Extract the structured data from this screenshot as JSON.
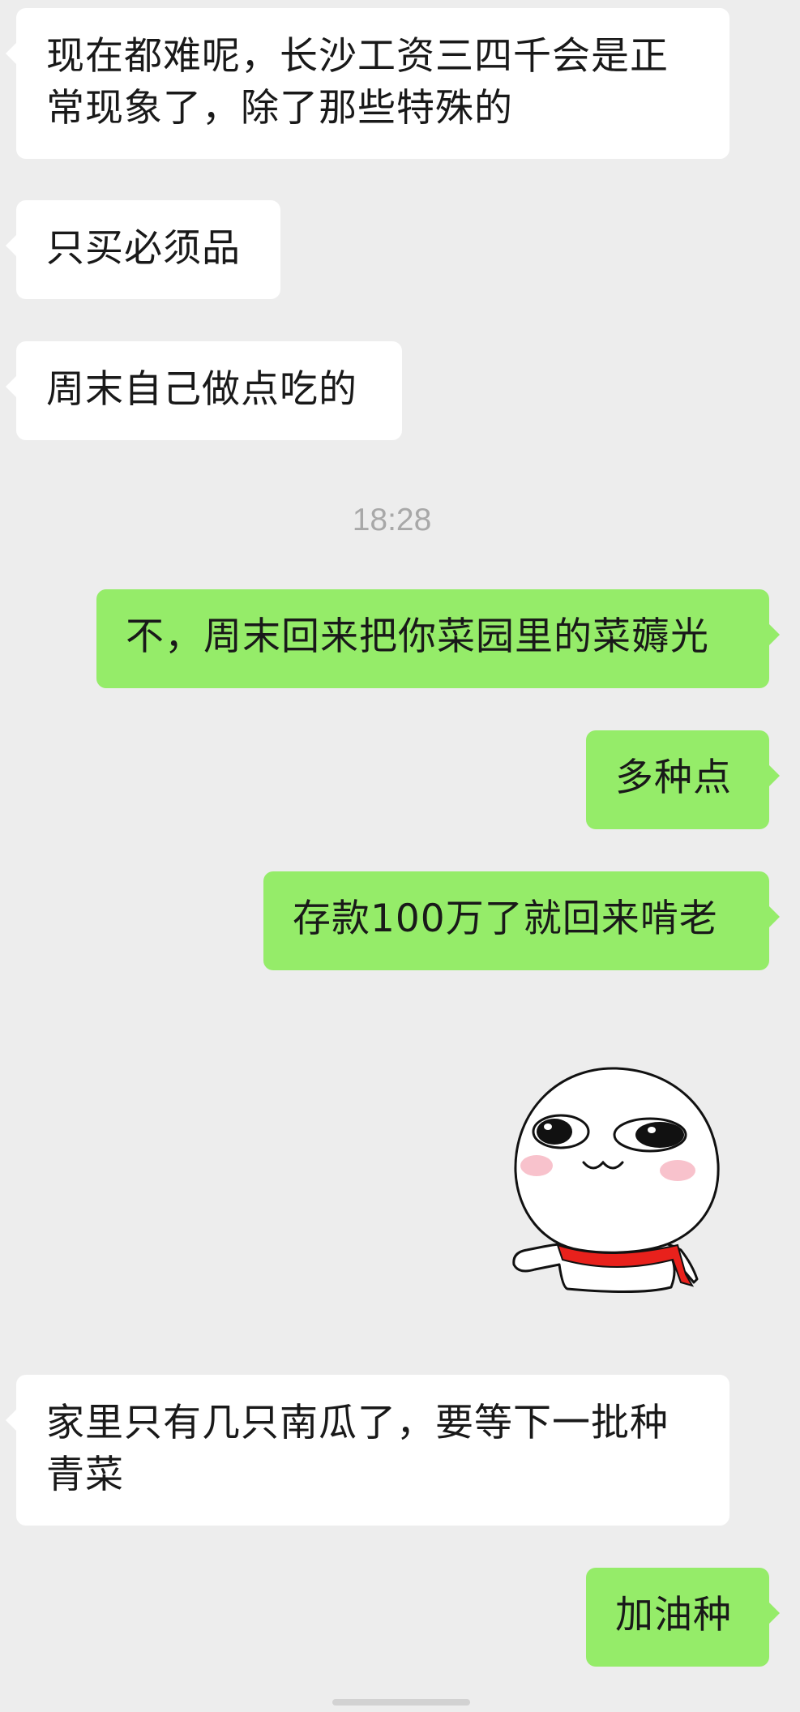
{
  "chat": {
    "timestamp": "18:28",
    "messages": [
      {
        "side": "in",
        "text": "现在都难呢，长沙工资三四千会是正常现象了，除了那些特殊的"
      },
      {
        "side": "in",
        "text": "只买必须品"
      },
      {
        "side": "in",
        "text": "周末自己做点吃的"
      },
      {
        "side": "out",
        "text": "不，周末回来把你菜园里的菜薅光"
      },
      {
        "side": "out",
        "text": "多种点"
      },
      {
        "side": "out",
        "text": "存款100万了就回来啃老"
      },
      {
        "side": "out",
        "type": "sticker",
        "icon": "smiling-face-sticker"
      },
      {
        "side": "in",
        "text": "家里只有几只南瓜了，要等下一批种青菜"
      },
      {
        "side": "out",
        "text": "加油种"
      }
    ]
  },
  "colors": {
    "background": "#ededed",
    "incoming_bubble": "#ffffff",
    "outgoing_bubble": "#95ec69",
    "text": "#191919",
    "timestamp": "#a8a8a8"
  }
}
